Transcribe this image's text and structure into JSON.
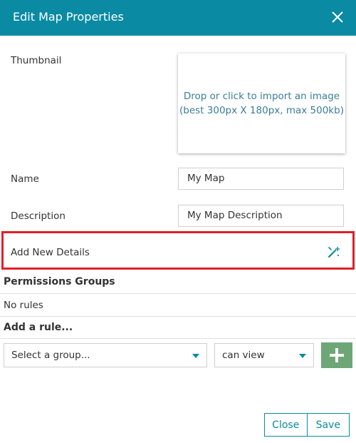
{
  "dialog": {
    "title": "Edit Map Properties",
    "close_icon": "close-icon"
  },
  "form": {
    "thumbnail_label": "Thumbnail",
    "thumbnail_hint_line1": "Drop or click to import an image",
    "thumbnail_hint_line2": "(best 300px X 180px, max 500kb)",
    "name_label": "Name",
    "name_value": "My Map",
    "description_label": "Description",
    "description_value": "My Map Description",
    "add_details_label": "Add New Details",
    "add_details_icon": "magic-wand-icon"
  },
  "permissions": {
    "title": "Permissions Groups",
    "empty_text": "No rules",
    "add_rule_title": "Add a rule...",
    "group_select_value": "Select a group...",
    "access_select_value": "can view",
    "add_button_icon": "plus-icon"
  },
  "footer": {
    "close_label": "Close",
    "save_label": "Save"
  },
  "colors": {
    "header": "#0a8aa3",
    "highlight_border": "#e02028",
    "add_button": "#6ea777",
    "link_text": "#3a7d9a"
  }
}
